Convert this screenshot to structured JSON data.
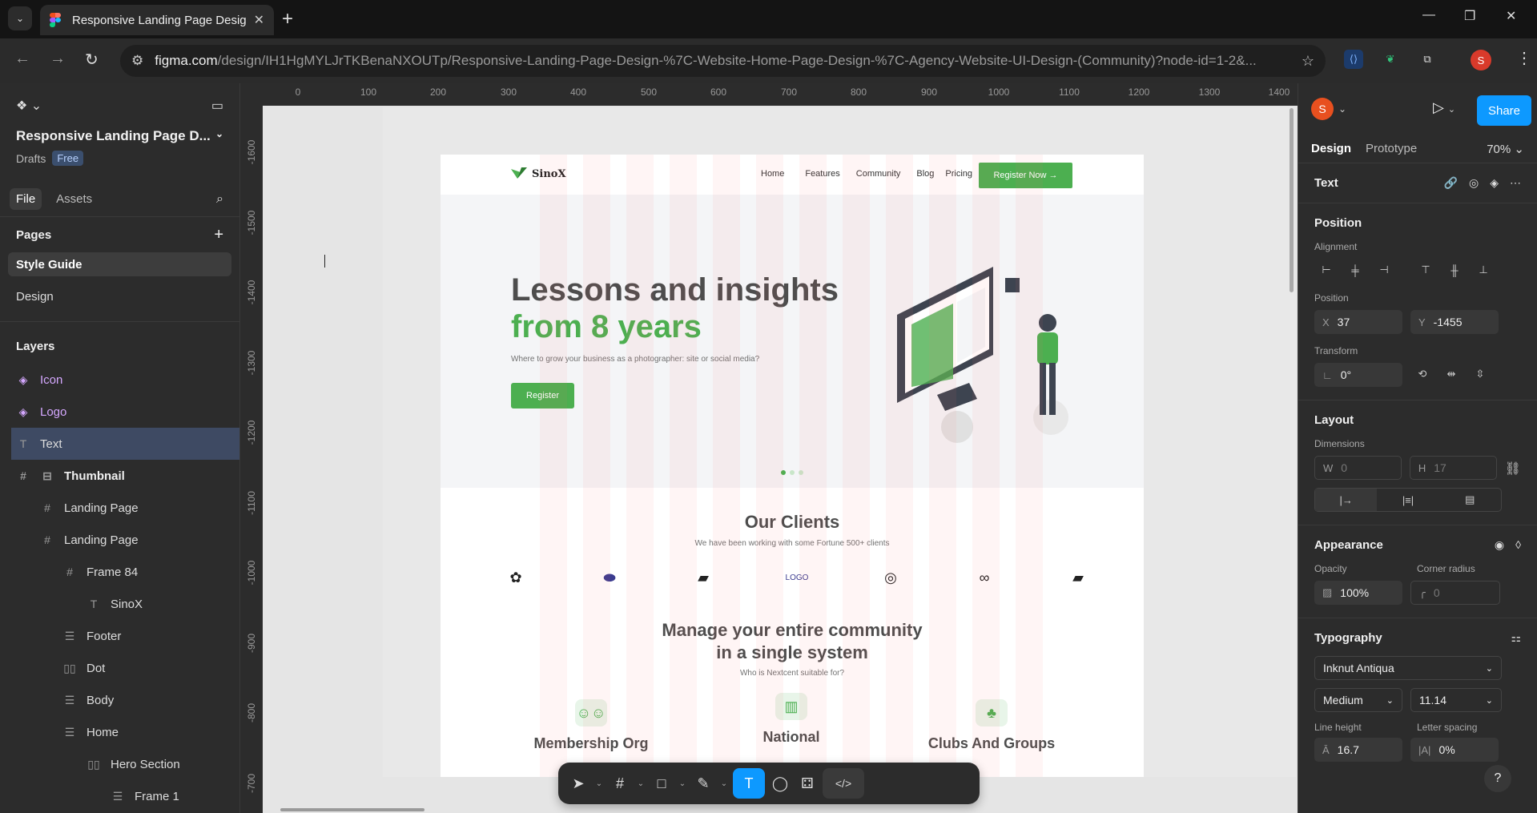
{
  "browser": {
    "tab_title": "Responsive Landing Page Desig",
    "url_host": "figma.com",
    "url_path": "/design/IH1HgMYLJrTKBenaNXOUTp/Responsive-Landing-Page-Design-%7C-Website-Home-Page-Design-%7C-Agency-Website-UI-Design-(Community)?node-id=1-2&...",
    "profile_initial": "S"
  },
  "left_panel": {
    "project_name": "Responsive Landing Page D...",
    "location": "Drafts",
    "plan_badge": "Free",
    "tabs": [
      "File",
      "Assets"
    ],
    "pages_title": "Pages",
    "pages": [
      "Style Guide",
      "Design"
    ],
    "layers_title": "Layers",
    "layers": [
      {
        "name": "Icon",
        "icon": "◈"
      },
      {
        "name": "Logo",
        "icon": "◈"
      },
      {
        "name": "Text",
        "icon": "T"
      },
      {
        "name": "Thumbnail",
        "icon": "⊟"
      },
      {
        "name": "Landing Page",
        "icon": "#"
      },
      {
        "name": "Landing Page",
        "icon": "#"
      },
      {
        "name": "Frame 84",
        "icon": "#"
      },
      {
        "name": "SinoX",
        "icon": "T"
      },
      {
        "name": "Footer",
        "icon": "☰"
      },
      {
        "name": "Dot",
        "icon": "▯▯"
      },
      {
        "name": "Body",
        "icon": "☰"
      },
      {
        "name": "Home",
        "icon": "☰"
      },
      {
        "name": "Hero Section",
        "icon": "▯▯"
      },
      {
        "name": "Frame 1",
        "icon": "☰"
      }
    ]
  },
  "rulers": {
    "top": [
      "0",
      "100",
      "200",
      "300",
      "400",
      "500",
      "600",
      "700",
      "800",
      "900",
      "1000",
      "1100",
      "1200",
      "1300",
      "1400"
    ],
    "left": [
      "-1600",
      "-1500",
      "-1400",
      "-1300",
      "-1200",
      "-1100",
      "-1000",
      "-900",
      "-800",
      "-700"
    ]
  },
  "landing": {
    "brand": "SinoX",
    "nav": [
      "Home",
      "Features",
      "Community",
      "Blog",
      "Pricing"
    ],
    "cta": "Register Now →",
    "hero_line1": "Lessons and insights",
    "hero_line2": "from 8 years",
    "hero_sub": "Where to grow your business as a photographer: site or social media?",
    "hero_button": "Register",
    "clients_title": "Our Clients",
    "clients_sub": "We have been working with some Fortune 500+ clients",
    "manage_title_1": "Manage your entire community",
    "manage_title_2": "in a single system",
    "manage_sub": "Who is Nextcent suitable for?",
    "cards": [
      "Membership Org",
      "National",
      "Clubs And Groups"
    ]
  },
  "right_panel": {
    "avatar_initial": "S",
    "share": "Share",
    "tab_design": "Design",
    "tab_prototype": "Prototype",
    "zoom": "70%",
    "selection_title": "Text",
    "position_title": "Position",
    "alignment_label": "Alignment",
    "position_label": "Position",
    "x": "37",
    "y": "-1455",
    "transform_label": "Transform",
    "rotation": "0°",
    "layout_title": "Layout",
    "dimensions_label": "Dimensions",
    "w": "0",
    "h": "17",
    "appearance_title": "Appearance",
    "opacity_label": "Opacity",
    "opacity": "100%",
    "corner_label": "Corner radius",
    "corner": "0",
    "typography_title": "Typography",
    "font": "Inknut Antiqua",
    "weight": "Medium",
    "size": "11.14",
    "line_height_label": "Line height",
    "line_height": "16.7",
    "letter_spacing_label": "Letter spacing",
    "letter_spacing": "0%"
  },
  "colors": {
    "accent": "#0d99ff",
    "brand_green": "#4caf50"
  }
}
